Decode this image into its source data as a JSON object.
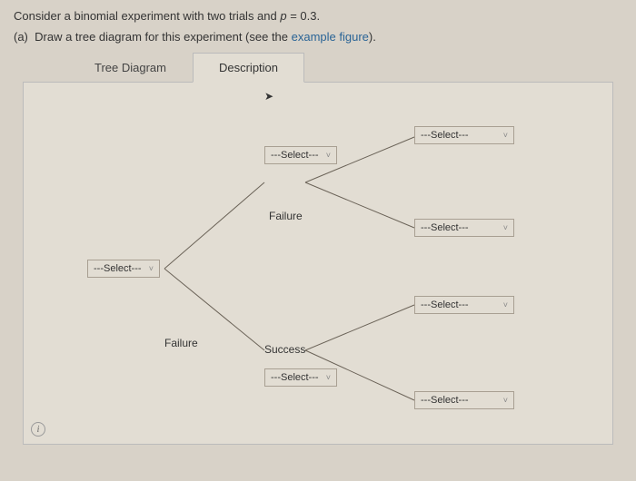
{
  "prompt": {
    "prefix": "Consider a binomial experiment with two trials and ",
    "var": "p",
    "eq": " = 0.3."
  },
  "partA": {
    "label": "(a)",
    "text": "Draw a tree diagram for this experiment (see the ",
    "link": "example figure",
    "after": ")."
  },
  "tabs": {
    "tree": "Tree Diagram",
    "desc": "Description"
  },
  "nodes": {
    "rootSelect": "---Select---",
    "upperBranchSelect": "---Select---",
    "failureLabel1": "Failure",
    "failureLabel2": "Failure",
    "successLabel": "Success",
    "lowerBranchSelect": "---Select---",
    "outcome1": "---Select---",
    "outcome2": "---Select---",
    "outcome3": "---Select---",
    "outcome4": "---Select---"
  },
  "icons": {
    "chevron": "˅",
    "cursor": "➤",
    "help": "i"
  }
}
